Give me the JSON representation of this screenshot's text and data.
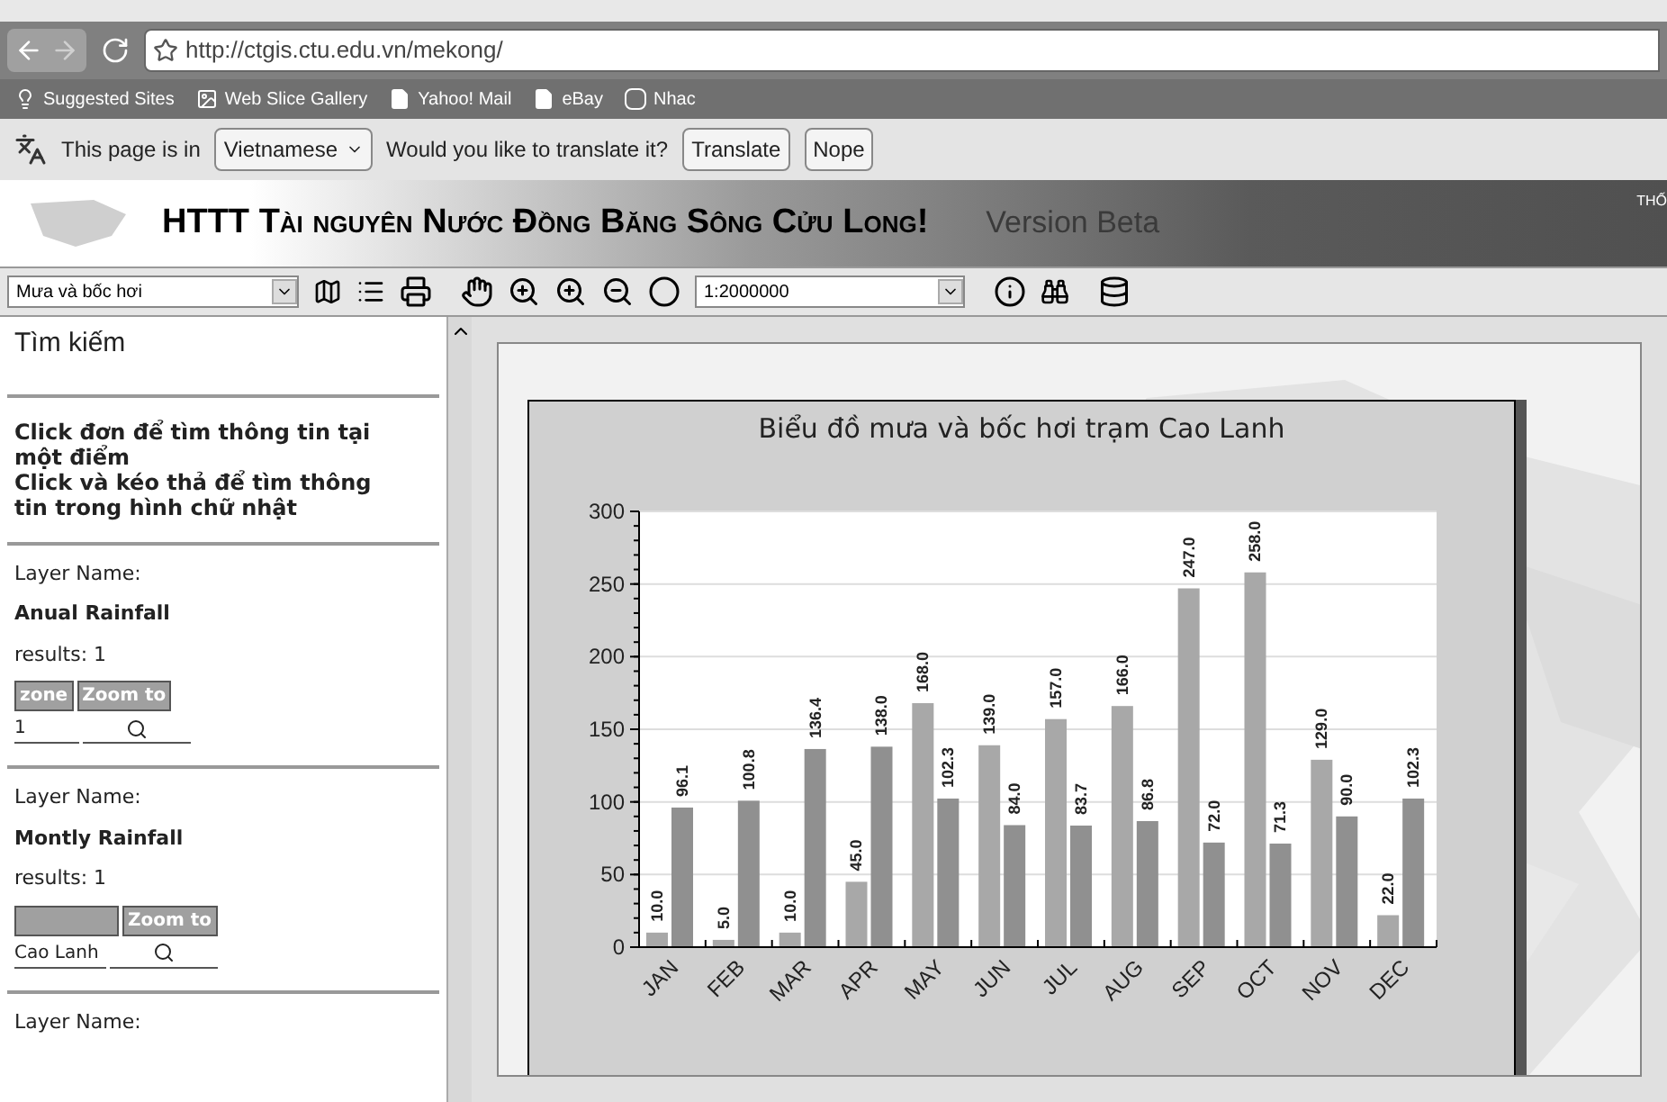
{
  "browser": {
    "url": "http://ctgis.ctu.edu.vn/mekong/",
    "bookmarks": [
      {
        "label": "Suggested Sites",
        "kind": "bulb"
      },
      {
        "label": "Web Slice Gallery",
        "kind": "slice"
      },
      {
        "label": "Yahoo! Mail",
        "kind": "page"
      },
      {
        "label": "eBay",
        "kind": "page"
      },
      {
        "label": "Nhac",
        "kind": "v"
      }
    ]
  },
  "translate_bar": {
    "prefix": "This page is in",
    "language": "Vietnamese",
    "question": "Would you like to translate it?",
    "buttons": [
      "Translate",
      "Nope"
    ]
  },
  "header": {
    "title": "HTTT Tài nguyên Nước Đồng Băng Sông Cửu Long!",
    "version": "Version Beta",
    "right_text": "THỐ"
  },
  "toolbar": {
    "layer_select": "Mưa và bốc hơi",
    "scale": "1:2000000"
  },
  "sidebar": {
    "title": "Tìm kiếm",
    "instructions": [
      "Click đơn để tìm thông tin tại một điểm",
      "Click và kéo thả để tìm thông tin trong hình chữ nhật"
    ],
    "layers": [
      {
        "label": "Layer Name:",
        "name": "Anual Rainfall",
        "results": "results: 1",
        "cells": [
          {
            "header": "zone",
            "value": "1"
          },
          {
            "header": "Zoom to",
            "kind": "zoom"
          }
        ]
      },
      {
        "label": "Layer Name:",
        "name": "Montly Rainfall",
        "results": "results: 1",
        "cells": [
          {
            "value": "Cao Lanh"
          },
          {
            "header": "Zoom to",
            "kind": "zoom"
          }
        ]
      },
      {
        "label": "Layer Name:"
      }
    ]
  },
  "chart": {
    "chart_data": {
      "type": "bar",
      "title": "Biểu đồ mưa và bốc hơi trạm Cao Lanh",
      "categories": [
        "JAN",
        "FEB",
        "MAR",
        "APR",
        "MAY",
        "JUN",
        "JUL",
        "AUG",
        "SEP",
        "OCT",
        "NOV",
        "DEC"
      ],
      "series": [
        {
          "color": "#a8a8a8",
          "values": [
            10.0,
            5.0,
            10.0,
            45.0,
            168.0,
            139.0,
            157.0,
            166.0,
            247.0,
            258.0,
            129.0,
            22.0
          ]
        },
        {
          "color": "#909090",
          "values": [
            96.1,
            100.8,
            136.4,
            138.0,
            102.3,
            84.0,
            83.7,
            86.8,
            72.0,
            71.3,
            90.0,
            102.3
          ]
        }
      ],
      "ylim": [
        0,
        300
      ],
      "yticks": [
        0,
        50,
        100,
        150,
        200,
        250,
        300
      ],
      "grid": true,
      "value_labels": [
        [
          "10.0",
          "5.0",
          "10.0",
          "45.0",
          "168.0",
          "139.0",
          "157.0",
          "166.0",
          "247.0",
          "258.0",
          "129.0",
          "22.0"
        ],
        [
          "96.1",
          "100.8",
          "136.4",
          "138.0",
          "102.3",
          "84.0",
          "83.7",
          "86.8",
          "72.0",
          "71.3",
          "90.0",
          "102.3"
        ]
      ]
    }
  }
}
